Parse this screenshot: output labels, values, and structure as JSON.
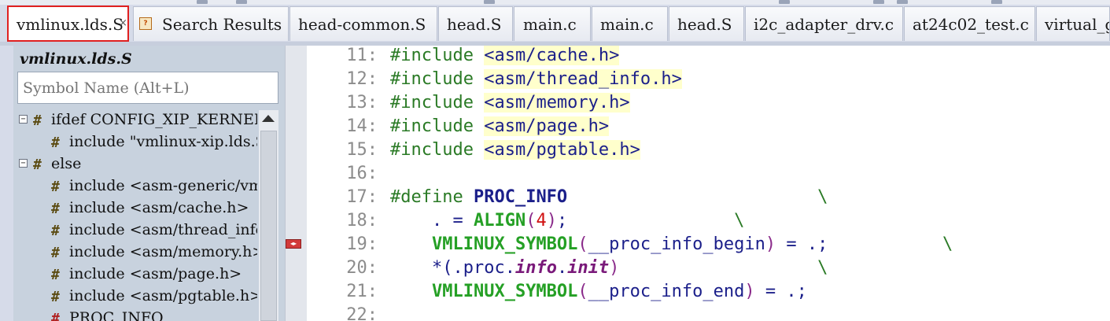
{
  "tabs": [
    {
      "label": "vmlinux.lds.S",
      "active": true,
      "icon": null,
      "close": "×"
    },
    {
      "label": "Search Results",
      "active": false,
      "icon": "search-results-icon"
    },
    {
      "label": "head-common.S",
      "active": false
    },
    {
      "label": "head.S",
      "active": false
    },
    {
      "label": "main.c",
      "active": false
    },
    {
      "label": "main.c",
      "active": false
    },
    {
      "label": "head.S",
      "active": false
    },
    {
      "label": "i2c_adapter_drv.c",
      "active": false
    },
    {
      "label": "at24c02_test.c",
      "active": false
    },
    {
      "label": "virtual_g",
      "active": false
    }
  ],
  "symbol_panel": {
    "title": "vmlinux.lds.S",
    "search_placeholder": "Symbol Name (Alt+L)",
    "tree": [
      {
        "toggle": "−",
        "label": "ifdef CONFIG_XIP_KERNEL",
        "level": 0,
        "icon": "hash-icon"
      },
      {
        "toggle": null,
        "label": "include \"vmlinux-xip.lds.S\"",
        "level": 1,
        "icon": "hash-icon"
      },
      {
        "toggle": "−",
        "label": "else",
        "level": 0,
        "icon": "hash-icon"
      },
      {
        "toggle": null,
        "label": "include <asm-generic/vmlinux.lds.h>",
        "level": 1,
        "icon": "hash-icon"
      },
      {
        "toggle": null,
        "label": "include <asm/cache.h>",
        "level": 1,
        "icon": "hash-icon"
      },
      {
        "toggle": null,
        "label": "include <asm/thread_info.h>",
        "level": 1,
        "icon": "hash-icon"
      },
      {
        "toggle": null,
        "label": "include <asm/memory.h>",
        "level": 1,
        "icon": "hash-icon"
      },
      {
        "toggle": null,
        "label": "include <asm/page.h>",
        "level": 1,
        "icon": "hash-icon"
      },
      {
        "toggle": null,
        "label": "include <asm/pgtable.h>",
        "level": 1,
        "icon": "hash-icon"
      },
      {
        "toggle": null,
        "label": "PROC_INFO",
        "level": 1,
        "icon": "define-icon"
      }
    ]
  },
  "editor": {
    "lines": [
      {
        "no": "11:",
        "tokens": [
          [
            "kw",
            "#include "
          ],
          [
            "inc",
            "<asm/cache.h>"
          ]
        ]
      },
      {
        "no": "12:",
        "tokens": [
          [
            "kw",
            "#include "
          ],
          [
            "inc",
            "<asm/thread_info.h>"
          ]
        ]
      },
      {
        "no": "13:",
        "tokens": [
          [
            "kw",
            "#include "
          ],
          [
            "inc",
            "<asm/memory.h>"
          ]
        ]
      },
      {
        "no": "14:",
        "tokens": [
          [
            "kw",
            "#include "
          ],
          [
            "inc",
            "<asm/page.h>"
          ]
        ]
      },
      {
        "no": "15:",
        "tokens": [
          [
            "kw",
            "#include "
          ],
          [
            "inc",
            "<asm/pgtable.h>"
          ]
        ]
      },
      {
        "no": "16:",
        "tokens": []
      },
      {
        "no": "17:",
        "tokens": [
          [
            "kw",
            "#define "
          ],
          [
            "id",
            "PROC_INFO"
          ],
          [
            "plain",
            "                        "
          ],
          [
            "bs",
            "\\"
          ]
        ]
      },
      {
        "no": "18:",
        "tokens": [
          [
            "plain",
            "    . = "
          ],
          [
            "sym",
            "ALIGN"
          ],
          [
            "paren",
            "("
          ],
          [
            "num",
            "4"
          ],
          [
            "paren",
            ")"
          ],
          [
            "plain",
            ";                "
          ],
          [
            "bs",
            "\\"
          ]
        ]
      },
      {
        "no": "19:",
        "tokens": [
          [
            "plain",
            "    "
          ],
          [
            "sym",
            "VMLINUX_SYMBOL"
          ],
          [
            "paren",
            "("
          ],
          [
            "plain",
            "__proc_info_begin"
          ],
          [
            "paren",
            ")"
          ],
          [
            "plain",
            " = .;           "
          ],
          [
            "bs",
            "\\"
          ]
        ]
      },
      {
        "no": "20:",
        "tokens": [
          [
            "plain",
            "    *(.proc."
          ],
          [
            "ital",
            "info"
          ],
          [
            "plain",
            "."
          ],
          [
            "ital",
            "init"
          ],
          [
            "paren",
            ")"
          ],
          [
            "plain",
            "                   "
          ],
          [
            "bs",
            "\\"
          ]
        ]
      },
      {
        "no": "21:",
        "tokens": [
          [
            "plain",
            "    "
          ],
          [
            "sym",
            "VMLINUX_SYMBOL"
          ],
          [
            "paren",
            "("
          ],
          [
            "plain",
            "__proc_info_end"
          ],
          [
            "paren",
            ")"
          ],
          [
            "plain",
            " = .;"
          ]
        ]
      },
      {
        "no": "22:",
        "tokens": []
      }
    ]
  },
  "colors": {
    "active_tab_border": "#e02020",
    "include_highlight": "#ffffcc",
    "keyword": "#2a7a25",
    "identifier": "#1b1f8a",
    "number": "#d01010"
  }
}
